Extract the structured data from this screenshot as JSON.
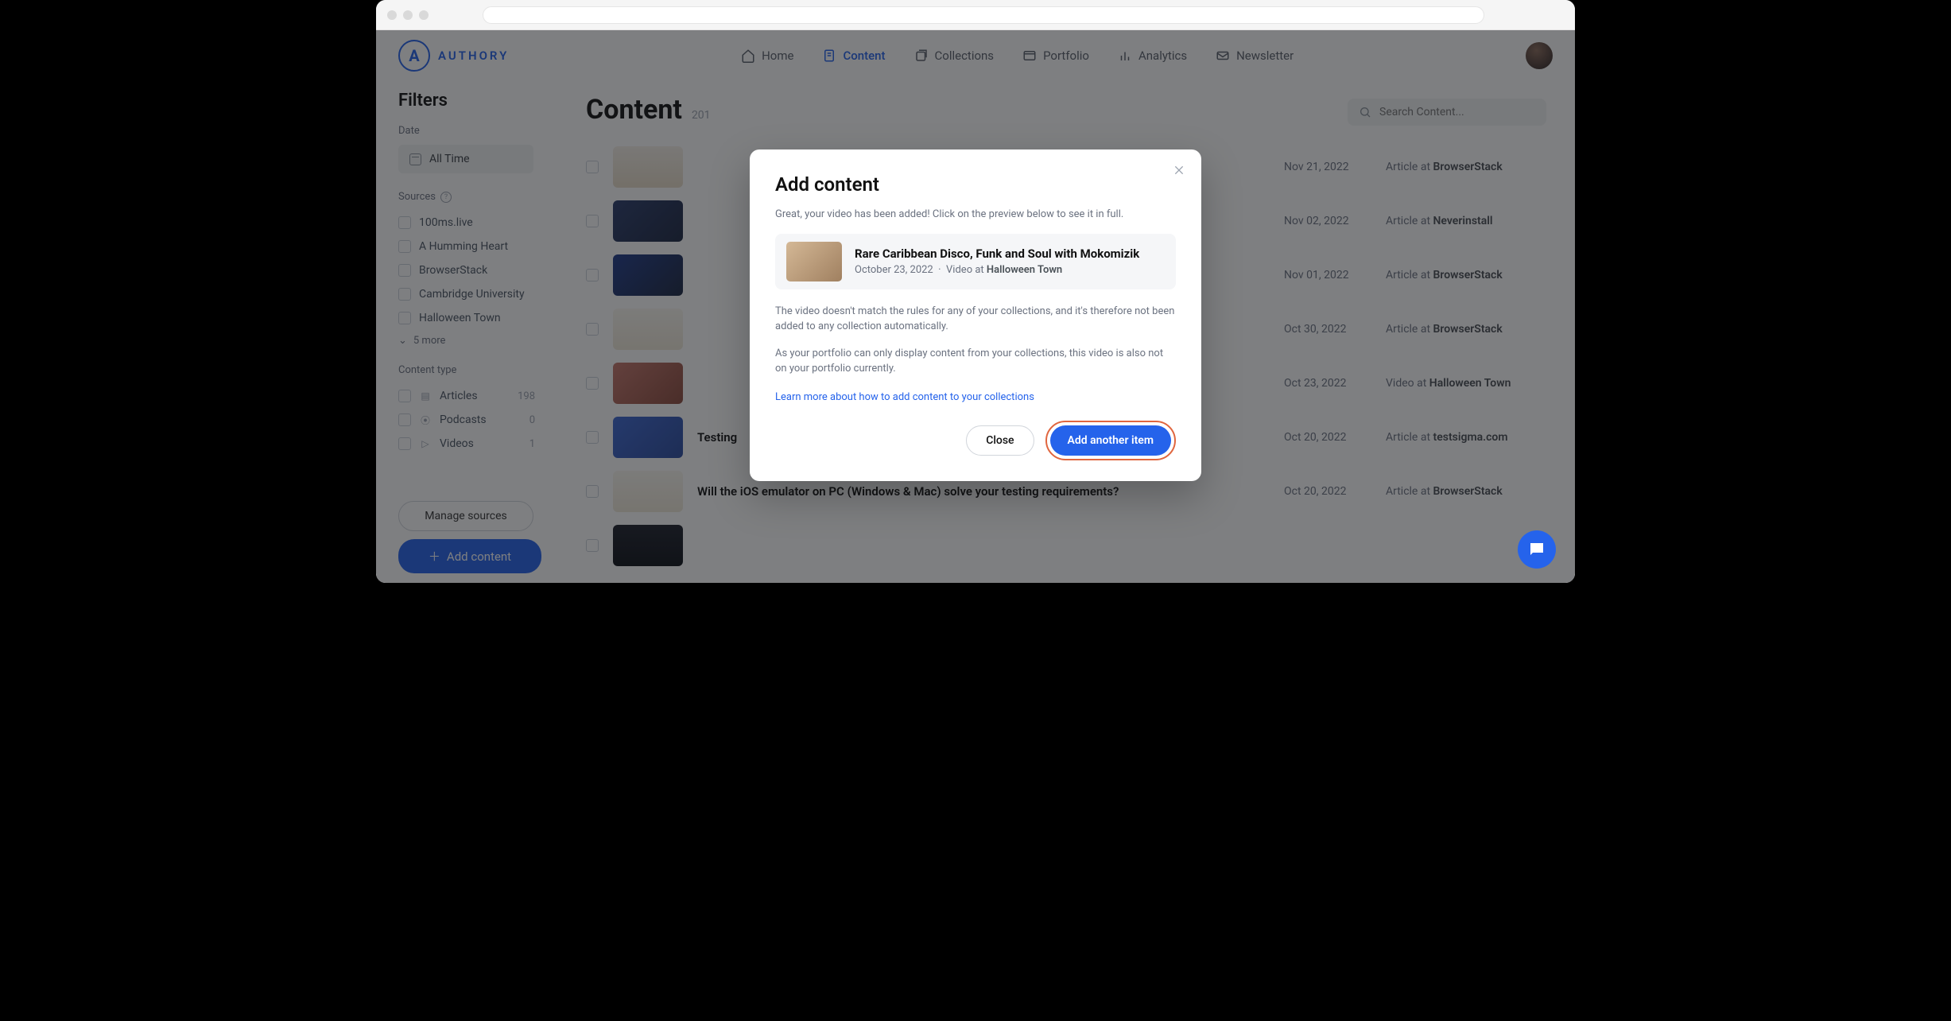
{
  "brand": "AUTHORY",
  "nav": {
    "home": "Home",
    "content": "Content",
    "collections": "Collections",
    "portfolio": "Portfolio",
    "analytics": "Analytics",
    "newsletter": "Newsletter"
  },
  "sidebar": {
    "title": "Filters",
    "date_label": "Date",
    "date_value": "All Time",
    "sources_label": "Sources",
    "sources": [
      "100ms.live",
      "A Humming Heart",
      "BrowserStack",
      "Cambridge University",
      "Halloween Town"
    ],
    "more": "5 more",
    "content_type_label": "Content type",
    "types": [
      {
        "label": "Articles",
        "count": "198"
      },
      {
        "label": "Podcasts",
        "count": "0"
      },
      {
        "label": "Videos",
        "count": "1"
      }
    ],
    "manage": "Manage sources",
    "add": "Add content"
  },
  "main": {
    "title": "Content",
    "count": "201",
    "search_placeholder": "Search Content...",
    "rows": [
      {
        "title": "",
        "date": "Nov 21, 2022",
        "type": "Article at",
        "source": "BrowserStack"
      },
      {
        "title": "",
        "date": "Nov 02, 2022",
        "type": "Article at",
        "source": "Neverinstall"
      },
      {
        "title": "",
        "date": "Nov 01, 2022",
        "type": "Article at",
        "source": "BrowserStack"
      },
      {
        "title": "",
        "date": "Oct 30, 2022",
        "type": "Article at",
        "source": "BrowserStack"
      },
      {
        "title": "",
        "date": "Oct 23, 2022",
        "type": "Video at",
        "source": "Halloween Town"
      },
      {
        "title": "Testing",
        "date": "Oct 20, 2022",
        "type": "Article at",
        "source": "testsigma.com"
      },
      {
        "title": "Will the iOS emulator on PC (Windows & Mac) solve your testing requirements?",
        "date": "Oct 20, 2022",
        "type": "Article at",
        "source": "BrowserStack"
      }
    ]
  },
  "modal": {
    "title": "Add content",
    "intro": "Great, your video has been added! Click on the preview below to see it in full.",
    "preview_title": "Rare Caribbean Disco, Funk and Soul with Mokomizik",
    "preview_date": "October 23, 2022",
    "preview_type": "Video at",
    "preview_source": "Halloween Town",
    "p1": "The video doesn't match the rules for any of your collections, and it's therefore not been added to any collection automatically.",
    "p2": "As your portfolio can only display content from your collections, this video is also not on your portfolio currently.",
    "link": "Learn more about how to add content to your collections",
    "close": "Close",
    "add_another": "Add another item"
  }
}
